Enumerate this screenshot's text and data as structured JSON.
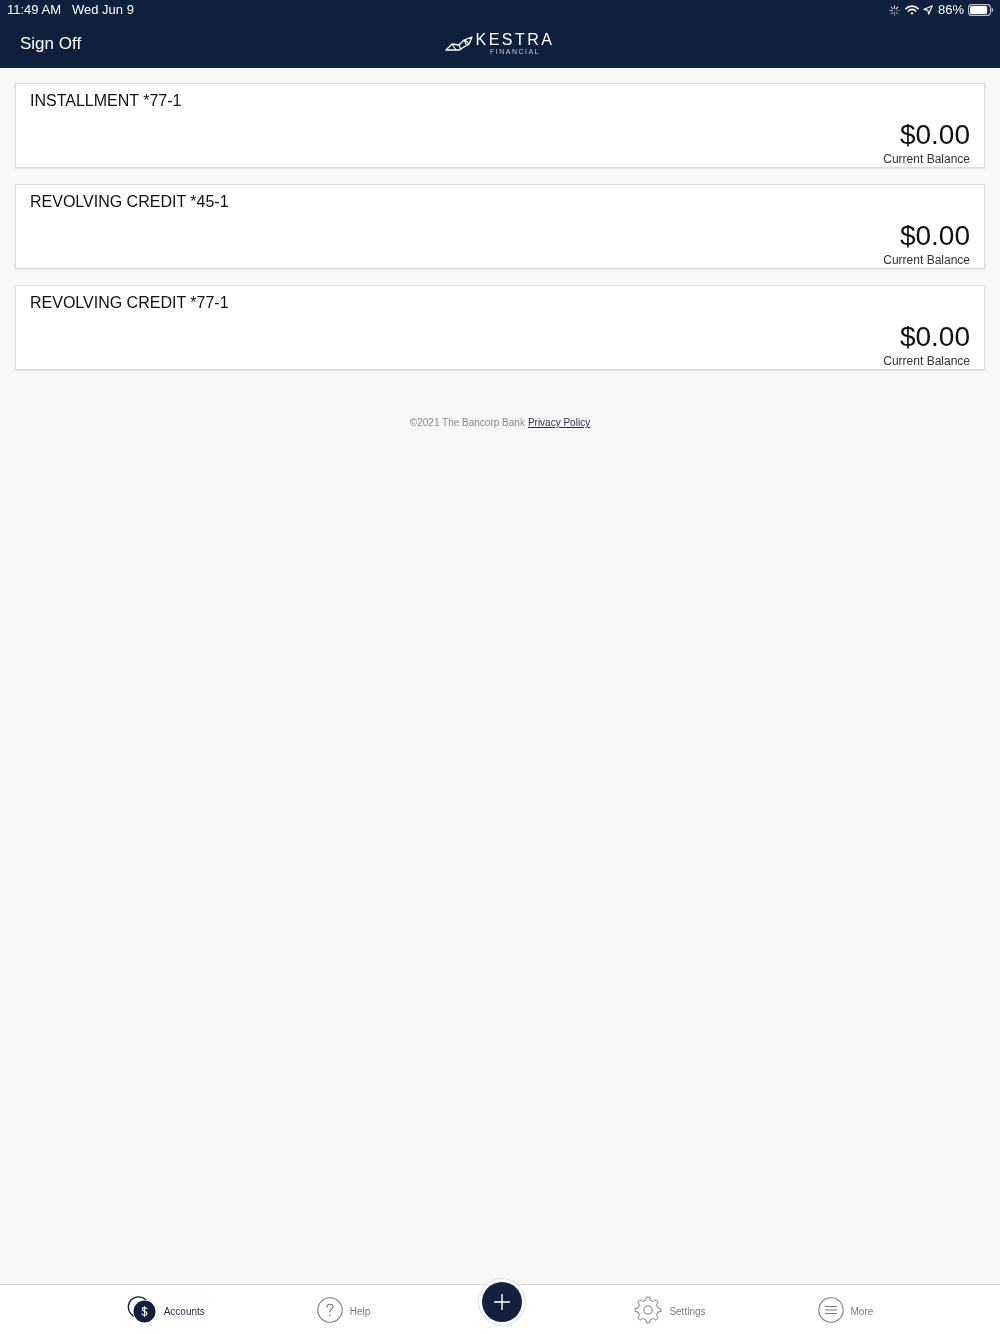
{
  "status_bar": {
    "time": "11:49 AM",
    "date": "Wed Jun 9",
    "battery": "86%"
  },
  "nav_bar": {
    "sign_off": "Sign Off",
    "logo": {
      "name": "KESTRA",
      "tagline": "FINANCIAL"
    }
  },
  "accounts": [
    {
      "name": "INSTALLMENT *77-1",
      "balance": "$0.00",
      "balance_label": "Current Balance"
    },
    {
      "name": "REVOLVING CREDIT *45-1",
      "balance": "$0.00",
      "balance_label": "Current Balance"
    },
    {
      "name": "REVOLVING CREDIT *77-1",
      "balance": "$0.00",
      "balance_label": "Current Balance"
    }
  ],
  "footer": {
    "copyright": "©2021 The Bancorp Bank",
    "link": "Privacy Policy"
  },
  "tab_bar": {
    "items": [
      {
        "kind": "accounts",
        "label": "Accounts",
        "selected": true
      },
      {
        "kind": "help",
        "label": "Help",
        "selected": false
      },
      {
        "kind": "add"
      },
      {
        "kind": "settings",
        "label": "Settings",
        "selected": false
      },
      {
        "kind": "more",
        "label": "More",
        "selected": false
      }
    ]
  }
}
